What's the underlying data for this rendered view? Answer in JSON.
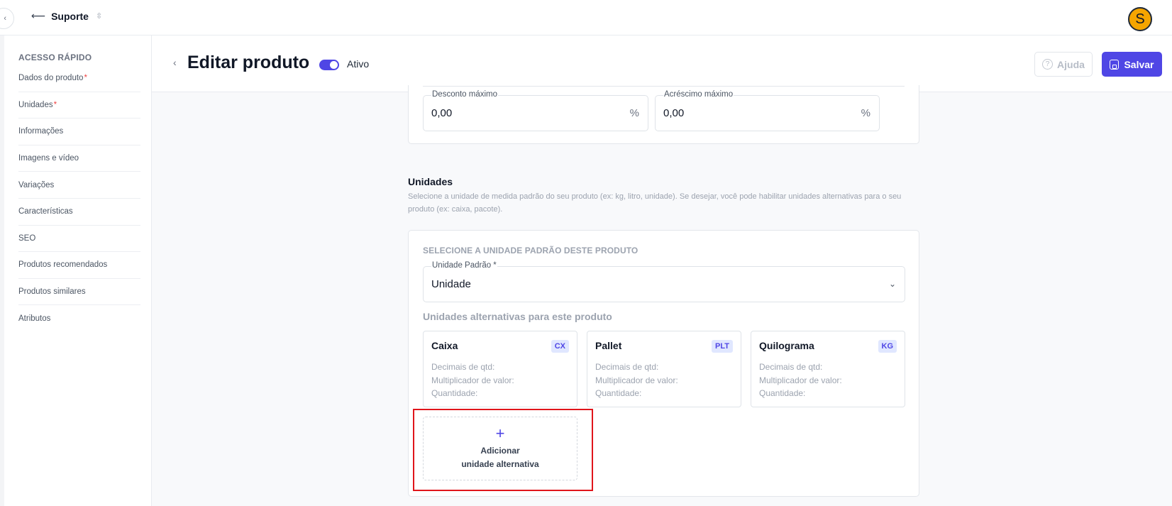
{
  "topbar": {
    "collapse_icon": "chevron-left-icon",
    "org_arrow": "⟵",
    "org_name": "Suporte",
    "org_sort_icon": "⇳",
    "avatar_letter": "S",
    "avatar_color": "#f5a500"
  },
  "sidebar": {
    "title": "ACESSO RÁPIDO",
    "items": [
      {
        "label": "Dados do produto",
        "required": "*"
      },
      {
        "label": "Unidades",
        "required": "*"
      },
      {
        "label": "Informações",
        "required": ""
      },
      {
        "label": "Imagens e vídeo",
        "required": ""
      },
      {
        "label": "Variações",
        "required": ""
      },
      {
        "label": "Características",
        "required": ""
      },
      {
        "label": "SEO",
        "required": ""
      },
      {
        "label": "Produtos recomendados",
        "required": ""
      },
      {
        "label": "Produtos similares",
        "required": ""
      },
      {
        "label": "Atributos",
        "required": ""
      }
    ]
  },
  "header": {
    "back": "‹",
    "title": "Editar produto",
    "toggle_label": "Ativo",
    "toggle_on": true,
    "help_icon": "?",
    "help_label": "Ajuda",
    "save_label": "Salvar",
    "accent": "#4f46e5"
  },
  "pricing": {
    "discount": {
      "label": "Desconto máximo",
      "value": "0,00",
      "unit": "%"
    },
    "surcharge": {
      "label": "Acréscimo máximo",
      "value": "0,00",
      "unit": "%"
    }
  },
  "units": {
    "title": "Unidades",
    "description": "Selecione a unidade de medida padrão do seu produto (ex: kg, litro, unidade). Se desejar, você pode habilitar unidades alternativas para o seu produto (ex: caixa, pacote).",
    "caption": "SELECIONE A UNIDADE PADRÃO DESTE PRODUTO",
    "default_select": {
      "label": "Unidade Padrão *",
      "value": "Unidade",
      "chevron": "⌄"
    },
    "alt_title": "Unidades alternativas para este produto",
    "alt_units": [
      {
        "name": "Caixa",
        "code": "CX",
        "decimals": "Decimais de qtd:",
        "multiplier": "Multiplicador de valor:",
        "quantity": "Quantidade:"
      },
      {
        "name": "Pallet",
        "code": "PLT",
        "decimals": "Decimais de qtd:",
        "multiplier": "Multiplicador de valor:",
        "quantity": "Quantidade:"
      },
      {
        "name": "Quilograma",
        "code": "KG",
        "decimals": "Decimais de qtd:",
        "multiplier": "Multiplicador de valor:",
        "quantity": "Quantidade:"
      }
    ],
    "add": {
      "icon": "+",
      "line1": "Adicionar",
      "line2": "unidade alternativa"
    }
  }
}
